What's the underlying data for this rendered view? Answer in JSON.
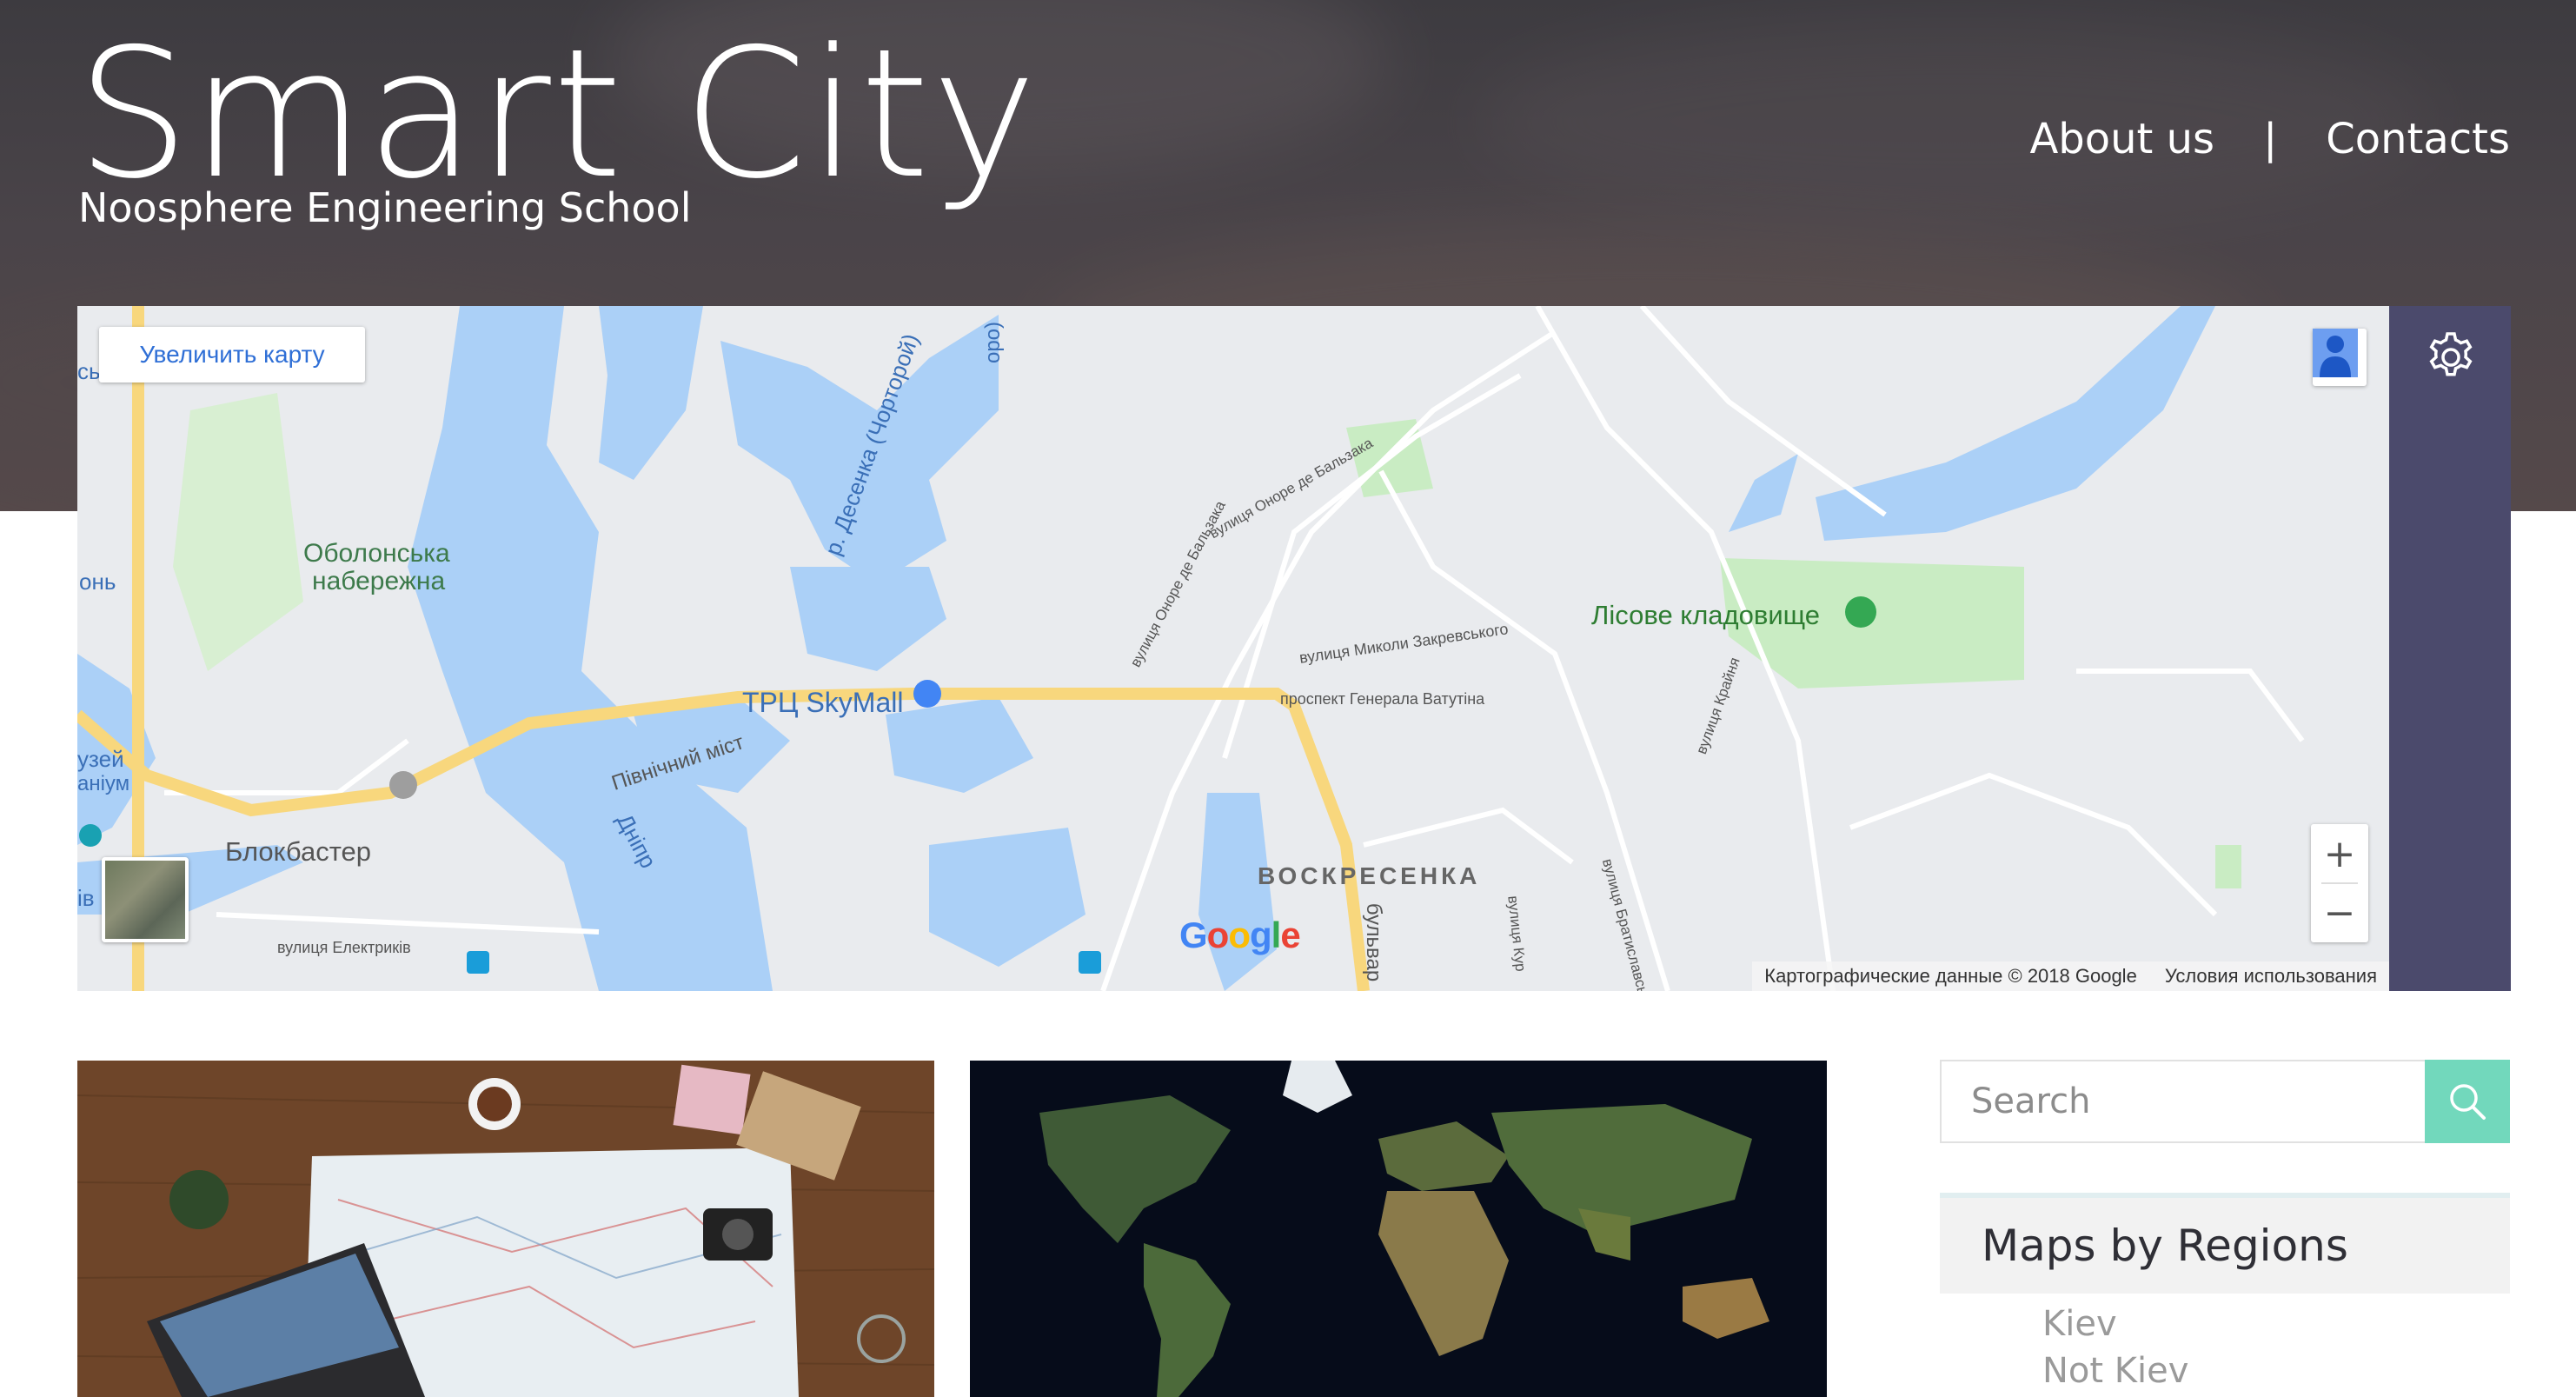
{
  "header": {
    "title": "Smart City",
    "subtitle": "Noosphere Engineering School",
    "nav": {
      "about": "About us",
      "separator": "|",
      "contacts": "Contacts"
    }
  },
  "map": {
    "enlarge_label": "Увеличить карту",
    "logo": [
      "G",
      "o",
      "o",
      "g",
      "l",
      "e"
    ],
    "attribution": "Картографические данные © 2018 Google",
    "terms": "Условия использования",
    "zoom_in": "+",
    "zoom_out": "−",
    "labels": {
      "obolon": "Оболонська",
      "obolon2": "набережна",
      "skymall": "ТРЦ SkyMall",
      "lisove": "Лісове кладовище",
      "blockbuster": "Блокбастер",
      "voskresenka": "ВОСКРЕСЕНКА",
      "bridge": "Північний міст",
      "dnipro": "Дніпр",
      "desna": "р. Десенка (Чорторой)",
      "balzac": "вулиця Оноре де Бальзака",
      "balzac2": "вулиця Оноре де Бальзака",
      "zakrevskoho": "вулиця Миколи Закревського",
      "vatutina": "проспект Генерала Ватутіна",
      "kraina": "вулиця Крайня",
      "elektrykiv": "вулиця Електриків",
      "bratyslavska": "вулиця Братиславсь",
      "left_onh": "онь",
      "left_sb": "сь",
      "left_muzei": "узей",
      "left_aniium": "аніум",
      "left_ib": "ів",
      "bulvar": "бульвар",
      "kurn": "вулиця Кур",
      "top_road": "оро)"
    }
  },
  "colors": {
    "water": "#abd0f7",
    "land": "#e9ebee",
    "park": "#c9ecc3",
    "road_major": "#f8d77d",
    "sidebar": "#4b4a6c",
    "search_button": "#72d8bc",
    "logo": [
      "#4285F4",
      "#EA4335",
      "#FBBC05",
      "#4285F4",
      "#34A853",
      "#EA4335"
    ]
  },
  "sidebar": {
    "search_placeholder": "Search",
    "regions_title": "Maps by Regions",
    "regions": [
      "Kiev",
      "Not Kiev"
    ]
  }
}
